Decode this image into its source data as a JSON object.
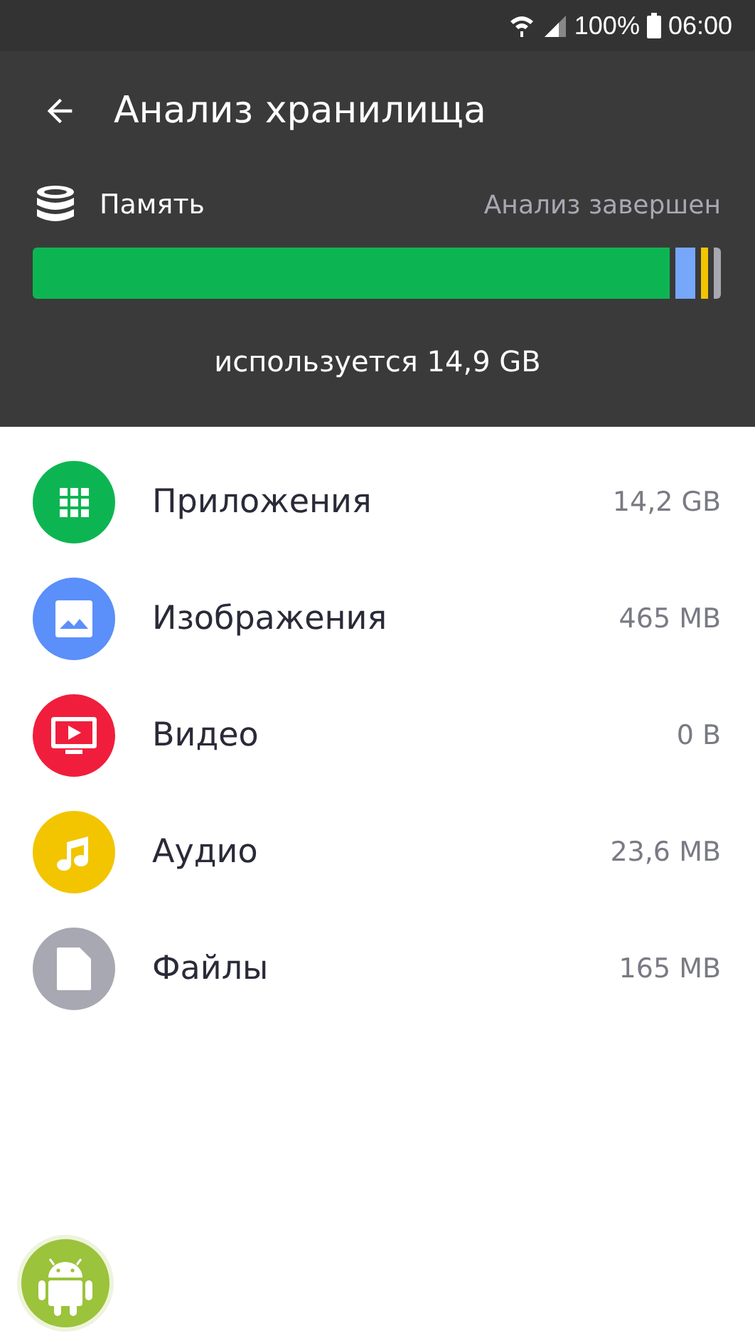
{
  "status_bar": {
    "battery": "100%",
    "time": "06:00"
  },
  "header": {
    "title": "Анализ хранилища",
    "storage_label": "Память",
    "analysis_status": "Анализ завершен",
    "used_text": "используется 14,9 GB"
  },
  "usage_bar": {
    "segments": [
      {
        "color": "#0db552"
      },
      {
        "color": "#77a7fb"
      },
      {
        "color": "#f2c500"
      },
      {
        "color": "#a8a8b2"
      }
    ]
  },
  "categories": [
    {
      "kind": "apps",
      "name": "Приложения",
      "size": "14,2 GB",
      "color": "#0db552"
    },
    {
      "kind": "images",
      "name": "Изображения",
      "size": "465 MB",
      "color": "#5b8ff9"
    },
    {
      "kind": "video",
      "name": "Видео",
      "size": "0 B",
      "color": "#f01e3c"
    },
    {
      "kind": "audio",
      "name": "Аудио",
      "size": "23,6 MB",
      "color": "#f2c500"
    },
    {
      "kind": "files",
      "name": "Файлы",
      "size": "165 MB",
      "color": "#a8a8b2"
    }
  ]
}
